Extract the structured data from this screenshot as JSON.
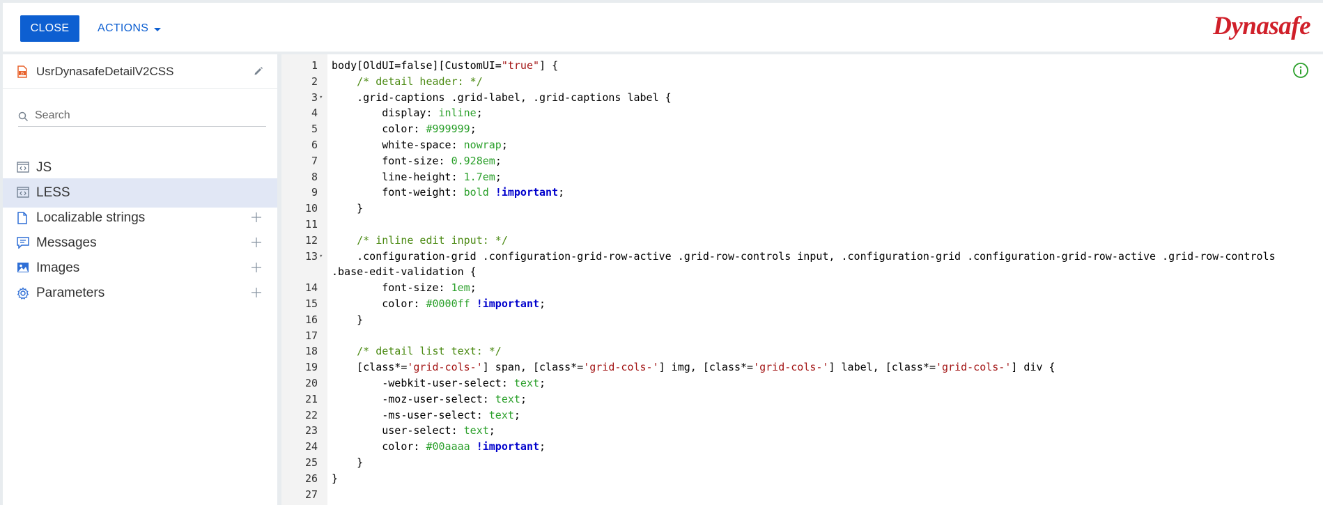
{
  "toolbar": {
    "close_label": "CLOSE",
    "actions_label": "ACTIONS"
  },
  "brand": {
    "logo_text": "Dynasafe",
    "color": "#d0202a"
  },
  "sidebar": {
    "file_name": "UsrDynasafeDetailV2CSS",
    "search_placeholder": "Search",
    "items": [
      {
        "label": "JS",
        "icon": "code-file-icon",
        "active": false,
        "addable": false
      },
      {
        "label": "LESS",
        "icon": "code-file-icon",
        "active": true,
        "addable": false
      },
      {
        "label": "Localizable strings",
        "icon": "document-icon",
        "active": false,
        "addable": true
      },
      {
        "label": "Messages",
        "icon": "message-icon",
        "active": false,
        "addable": true
      },
      {
        "label": "Images",
        "icon": "image-icon",
        "active": false,
        "addable": true
      },
      {
        "label": "Parameters",
        "icon": "gear-icon",
        "active": false,
        "addable": true
      }
    ]
  },
  "editor": {
    "lines": [
      {
        "n": "1",
        "fold": false,
        "segs": [
          [
            "t",
            "body[OldUI=false][CustomUI="
          ],
          [
            "s",
            "\"true\""
          ],
          [
            "t",
            "] {"
          ]
        ]
      },
      {
        "n": "2",
        "fold": false,
        "segs": [
          [
            "t",
            "    "
          ],
          [
            "c",
            "/* detail header: */"
          ]
        ]
      },
      {
        "n": "3",
        "fold": true,
        "segs": [
          [
            "t",
            "    .grid-captions .grid-label, .grid-captions label {"
          ]
        ]
      },
      {
        "n": "4",
        "fold": false,
        "segs": [
          [
            "t",
            "        display: "
          ],
          [
            "v",
            "inline"
          ],
          [
            "t",
            ";"
          ]
        ]
      },
      {
        "n": "5",
        "fold": false,
        "segs": [
          [
            "t",
            "        color: "
          ],
          [
            "v",
            "#999999"
          ],
          [
            "t",
            ";"
          ]
        ]
      },
      {
        "n": "6",
        "fold": false,
        "segs": [
          [
            "t",
            "        white-space: "
          ],
          [
            "v",
            "nowrap"
          ],
          [
            "t",
            ";"
          ]
        ]
      },
      {
        "n": "7",
        "fold": false,
        "segs": [
          [
            "t",
            "        font-size: "
          ],
          [
            "v",
            "0.928em"
          ],
          [
            "t",
            ";"
          ]
        ]
      },
      {
        "n": "8",
        "fold": false,
        "segs": [
          [
            "t",
            "        line-height: "
          ],
          [
            "v",
            "1.7em"
          ],
          [
            "t",
            ";"
          ]
        ]
      },
      {
        "n": "9",
        "fold": false,
        "segs": [
          [
            "t",
            "        font-weight: "
          ],
          [
            "v",
            "bold"
          ],
          [
            "t",
            " "
          ],
          [
            "i",
            "!important"
          ],
          [
            "t",
            ";"
          ]
        ]
      },
      {
        "n": "10",
        "fold": false,
        "segs": [
          [
            "t",
            "    }"
          ]
        ]
      },
      {
        "n": "11",
        "fold": false,
        "segs": [
          [
            "t",
            ""
          ]
        ]
      },
      {
        "n": "12",
        "fold": false,
        "segs": [
          [
            "t",
            "    "
          ],
          [
            "c",
            "/* inline edit input: */"
          ]
        ]
      },
      {
        "n": "13",
        "fold": true,
        "segs": [
          [
            "t",
            "    .configuration-grid .configuration-grid-row-active .grid-row-controls input, .configuration-grid .configuration-grid-row-active .grid-row-controls"
          ]
        ]
      },
      {
        "n": "",
        "fold": false,
        "segs": [
          [
            "t",
            ".base-edit-validation {"
          ]
        ]
      },
      {
        "n": "14",
        "fold": false,
        "segs": [
          [
            "t",
            "        font-size: "
          ],
          [
            "v",
            "1em"
          ],
          [
            "t",
            ";"
          ]
        ]
      },
      {
        "n": "15",
        "fold": false,
        "segs": [
          [
            "t",
            "        color: "
          ],
          [
            "v",
            "#0000ff"
          ],
          [
            "t",
            " "
          ],
          [
            "i",
            "!important"
          ],
          [
            "t",
            ";"
          ]
        ]
      },
      {
        "n": "16",
        "fold": false,
        "segs": [
          [
            "t",
            "    }"
          ]
        ]
      },
      {
        "n": "17",
        "fold": false,
        "segs": [
          [
            "t",
            ""
          ]
        ]
      },
      {
        "n": "18",
        "fold": false,
        "segs": [
          [
            "t",
            "    "
          ],
          [
            "c",
            "/* detail list text: */"
          ]
        ]
      },
      {
        "n": "19",
        "fold": false,
        "segs": [
          [
            "t",
            "    [class*="
          ],
          [
            "s",
            "'grid-cols-'"
          ],
          [
            "t",
            "] span, [class*="
          ],
          [
            "s",
            "'grid-cols-'"
          ],
          [
            "t",
            "] img, [class*="
          ],
          [
            "s",
            "'grid-cols-'"
          ],
          [
            "t",
            "] label, [class*="
          ],
          [
            "s",
            "'grid-cols-'"
          ],
          [
            "t",
            "] div {"
          ]
        ]
      },
      {
        "n": "20",
        "fold": false,
        "segs": [
          [
            "t",
            "        -webkit-user-select: "
          ],
          [
            "v",
            "text"
          ],
          [
            "t",
            ";"
          ]
        ]
      },
      {
        "n": "21",
        "fold": false,
        "segs": [
          [
            "t",
            "        -moz-user-select: "
          ],
          [
            "v",
            "text"
          ],
          [
            "t",
            ";"
          ]
        ]
      },
      {
        "n": "22",
        "fold": false,
        "segs": [
          [
            "t",
            "        -ms-user-select: "
          ],
          [
            "v",
            "text"
          ],
          [
            "t",
            ";"
          ]
        ]
      },
      {
        "n": "23",
        "fold": false,
        "segs": [
          [
            "t",
            "        user-select: "
          ],
          [
            "v",
            "text"
          ],
          [
            "t",
            ";"
          ]
        ]
      },
      {
        "n": "24",
        "fold": false,
        "segs": [
          [
            "t",
            "        color: "
          ],
          [
            "v",
            "#00aaaa"
          ],
          [
            "t",
            " "
          ],
          [
            "i",
            "!important"
          ],
          [
            "t",
            ";"
          ]
        ]
      },
      {
        "n": "25",
        "fold": false,
        "segs": [
          [
            "t",
            "    }"
          ]
        ]
      },
      {
        "n": "26",
        "fold": false,
        "segs": [
          [
            "t",
            "}"
          ]
        ]
      },
      {
        "n": "27",
        "fold": false,
        "segs": [
          [
            "t",
            ""
          ]
        ]
      }
    ]
  }
}
